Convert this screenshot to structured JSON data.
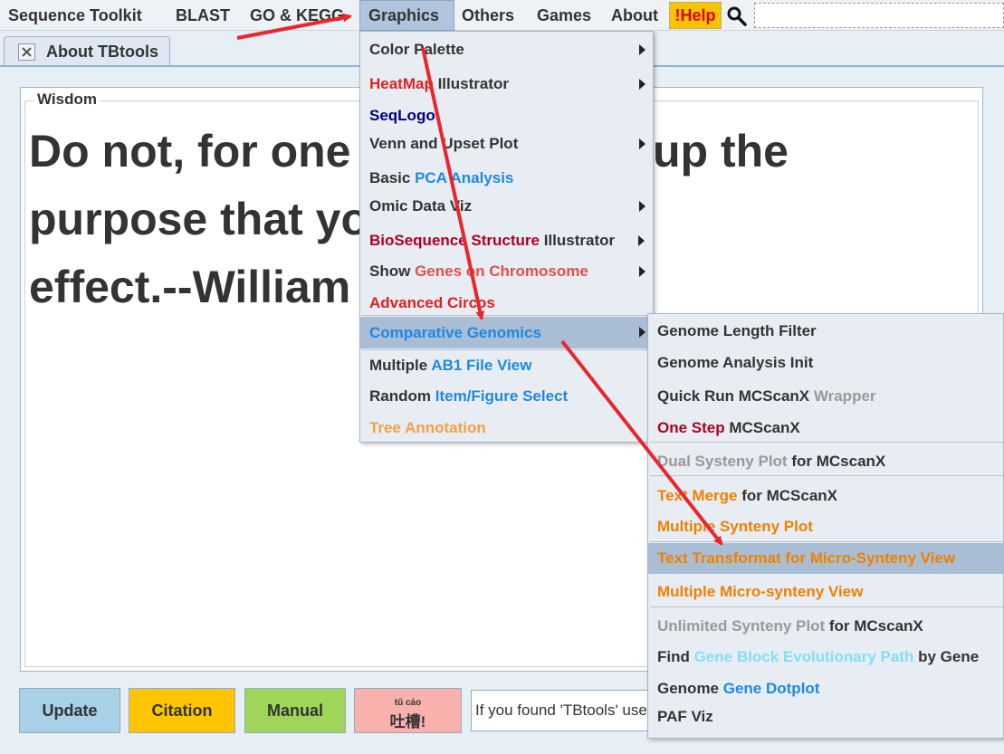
{
  "menubar": {
    "items": [
      "Sequence Toolkit",
      "BLAST",
      "GO & KEGG",
      "Graphics",
      "Others",
      "Games",
      "About"
    ],
    "help_label": "!Help",
    "search_icon": "search-icon",
    "search_value": ""
  },
  "tab": {
    "label": "About TBtools",
    "close_icon": "close-icon"
  },
  "wisdom": {
    "legend": "Wisdom",
    "line1": "Do not, for one repulse, give up the",
    "line2": "purpose that you resolved to",
    "line3": "effect.--William Shakespeare"
  },
  "buttons": {
    "update": "Update",
    "citation": "Citation",
    "manual": "Manual",
    "tucao_pinyin": "tǔ   cáo",
    "tucao_text": "吐槽!"
  },
  "feedback_text": "If you found 'TBtools' useful",
  "graphics_menu": {
    "color_palette": "Color Palette",
    "heatmap_a": "HeatMap",
    "heatmap_b": " Illustrator",
    "seqlogo": "SeqLogo",
    "venn": "Venn and Upset Plot",
    "pca_a": "Basic ",
    "pca_b": "PCA Analysis",
    "omic": "Omic Data Viz",
    "bioseq_a": "BioSequence Structure",
    "bioseq_b": " Illustrator",
    "genes_a": "Show ",
    "genes_b": "Genes on Chromosome",
    "circos": "Advanced Circos",
    "comparative": "Comparative Genomics",
    "ab1_a": "Multiple ",
    "ab1_b": "AB1 File View",
    "random_a": "Random ",
    "random_b": "Item/Figure Select",
    "tree": "Tree Annotation"
  },
  "comparative_menu": {
    "length_filter": "Genome Length Filter",
    "analysis_init": "Genome Analysis Init",
    "quickrun_a": "Quick Run MCScanX ",
    "quickrun_b": "Wrapper",
    "onestep_a": "One Step",
    "onestep_b": " MCScanX",
    "dual_a": "Dual Systeny Plot",
    "dual_b": " for MCscanX",
    "textmerge_a": "Text Merge",
    "textmerge_b": " for MCScanX",
    "multisynteny": "Multiple Synteny Plot",
    "transformat": "Text Transformat for Micro-Synteny View",
    "micro": "Multiple Micro-synteny View",
    "unlimited_a": "Unlimited Synteny Plot",
    "unlimited_b": " for MCscanX",
    "find_a": "Find ",
    "find_b": "Gene Block Evolutionary Path",
    "find_c": " by Gene",
    "dotplot_a": "Genome ",
    "dotplot_b": "Gene Dotplot",
    "paf": "PAF Viz"
  },
  "colors": {
    "highlight": "#a9bdd4",
    "annotation_arrow": "#e8262b",
    "help_bg": "#f8c400"
  }
}
